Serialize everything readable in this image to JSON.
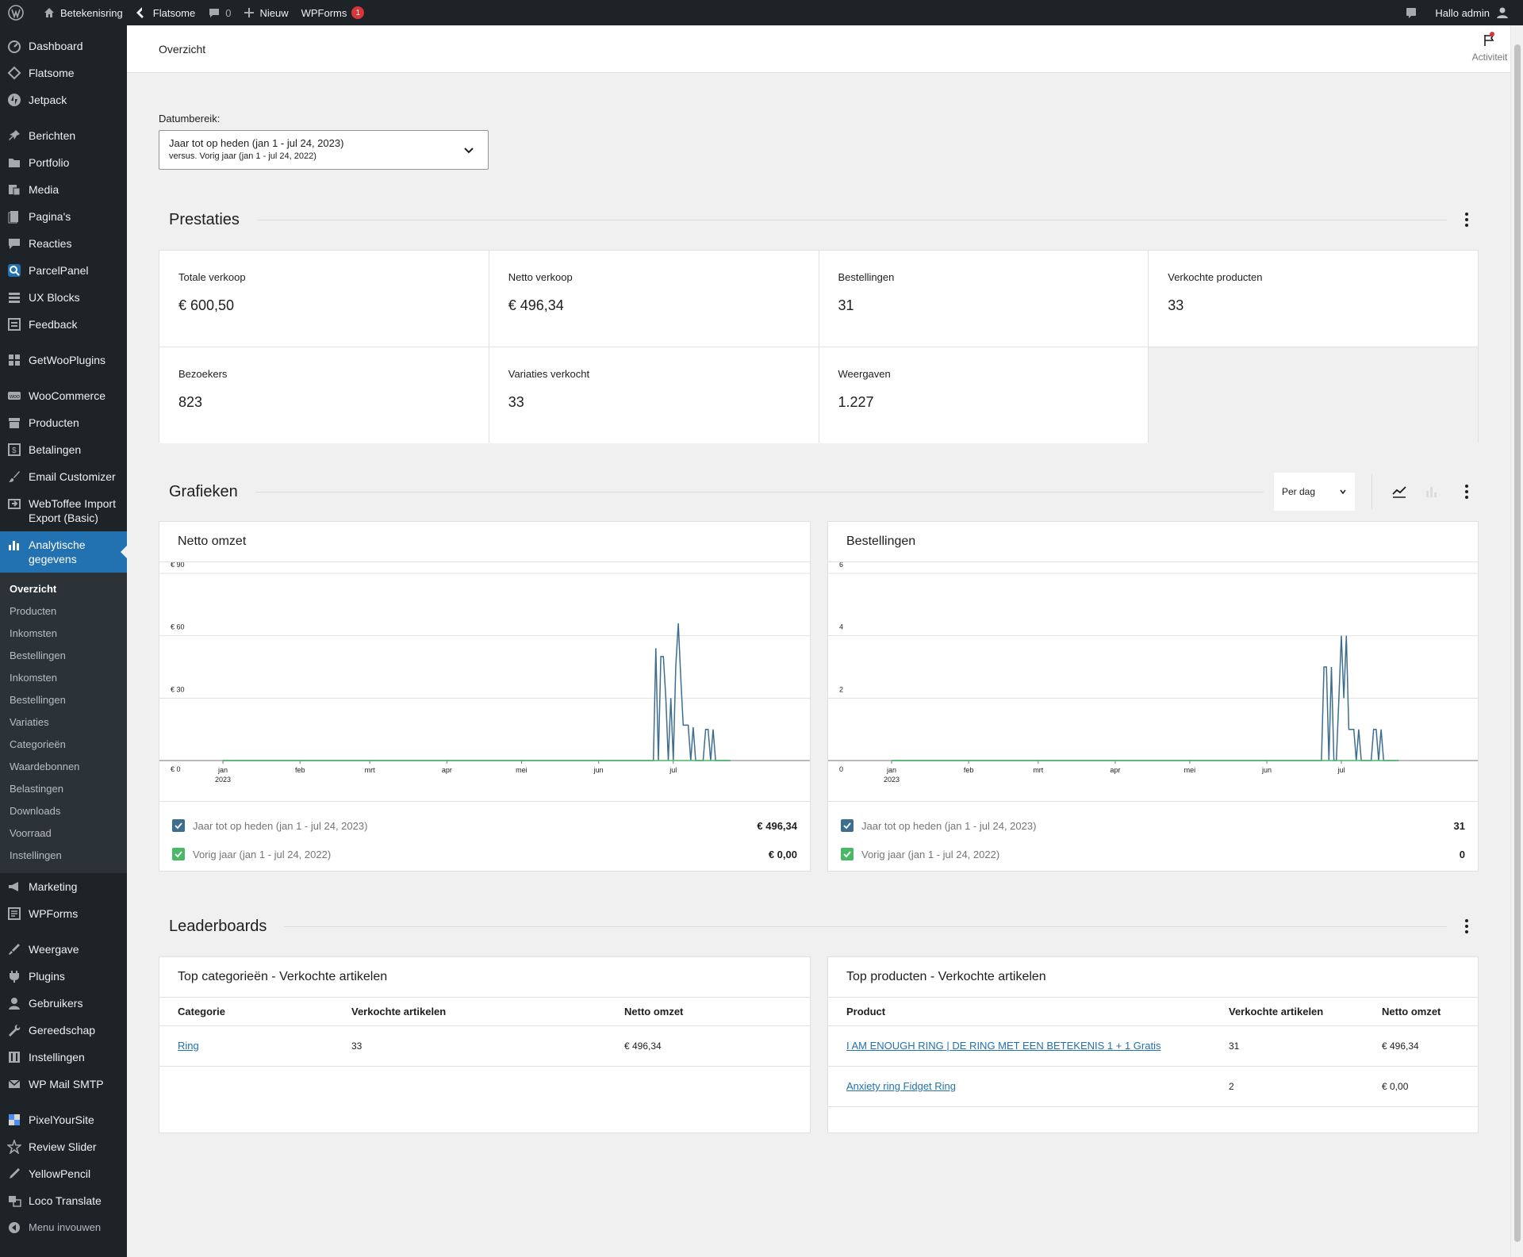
{
  "adminbar": {
    "site_name": "Betekenisring",
    "theme": "Flatsome",
    "comments_count": "0",
    "new_label": "Nieuw",
    "wpforms_label": "WPForms",
    "wpforms_badge": "1",
    "greeting": "Hallo admin"
  },
  "sidebar": {
    "items_top": [
      {
        "label": "Dashboard",
        "icon": "dashboard-icon"
      },
      {
        "label": "Flatsome",
        "icon": "flatsome-icon"
      },
      {
        "label": "Jetpack",
        "icon": "jetpack-icon"
      }
    ],
    "items_content": [
      {
        "label": "Berichten",
        "icon": "pin-icon"
      },
      {
        "label": "Portfolio",
        "icon": "folder-icon"
      },
      {
        "label": "Media",
        "icon": "media-icon"
      },
      {
        "label": "Pagina's",
        "icon": "page-icon"
      },
      {
        "label": "Reacties",
        "icon": "comment-icon"
      },
      {
        "label": "ParcelPanel",
        "icon": "parcel-icon"
      },
      {
        "label": "UX Blocks",
        "icon": "blocks-icon"
      },
      {
        "label": "Feedback",
        "icon": "feedback-icon"
      }
    ],
    "item_getwoo": {
      "label": "GetWooPlugins",
      "icon": "plugin-grid-icon"
    },
    "items_woo": [
      {
        "label": "WooCommerce",
        "icon": "woo-icon"
      },
      {
        "label": "Producten",
        "icon": "archive-icon"
      },
      {
        "label": "Betalingen",
        "icon": "dollar-icon"
      },
      {
        "label": "Email Customizer",
        "icon": "brush-icon"
      },
      {
        "label": "WebToffee Import Export (Basic)",
        "icon": "import-icon"
      }
    ],
    "current_item": {
      "label": "Analytische gegevens",
      "icon": "bar-chart-icon"
    },
    "submenu": [
      "Overzicht",
      "Producten",
      "Inkomsten",
      "Bestellingen",
      "Inkomsten",
      "Bestellingen",
      "Variaties",
      "Categorieën",
      "Waardebonnen",
      "Belastingen",
      "Downloads",
      "Voorraad",
      "Instellingen"
    ],
    "items_marketing": [
      {
        "label": "Marketing",
        "icon": "megaphone-icon"
      },
      {
        "label": "WPForms",
        "icon": "form-icon"
      }
    ],
    "items_admin": [
      {
        "label": "Weergave",
        "icon": "appearance-icon"
      },
      {
        "label": "Plugins",
        "icon": "plugin-icon"
      },
      {
        "label": "Gebruikers",
        "icon": "user-icon"
      },
      {
        "label": "Gereedschap",
        "icon": "wrench-icon"
      },
      {
        "label": "Instellingen",
        "icon": "settings-icon"
      },
      {
        "label": "WP Mail SMTP",
        "icon": "mail-icon"
      }
    ],
    "items_extra": [
      {
        "label": "PixelYourSite",
        "icon": "pixel-icon"
      },
      {
        "label": "Review Slider",
        "icon": "star-icon"
      },
      {
        "label": "YellowPencil",
        "icon": "pencil-icon"
      },
      {
        "label": "Loco Translate",
        "icon": "translate-icon"
      }
    ],
    "collapse_label": "Menu invouwen"
  },
  "header": {
    "title": "Overzicht",
    "activity_label": "Activiteit"
  },
  "date_range": {
    "label": "Datumbereik:",
    "primary": "Jaar tot op heden (jan 1 - jul 24, 2023)",
    "secondary": "versus. Vorig jaar (jan 1 - jul 24, 2022)"
  },
  "performance": {
    "title": "Prestaties",
    "cards": [
      {
        "label": "Totale verkoop",
        "value": "€ 600,50"
      },
      {
        "label": "Netto verkoop",
        "value": "€ 496,34"
      },
      {
        "label": "Bestellingen",
        "value": "31"
      },
      {
        "label": "Verkochte producten",
        "value": "33"
      },
      {
        "label": "Bezoekers",
        "value": "823"
      },
      {
        "label": "Variaties verkocht",
        "value": "33"
      },
      {
        "label": "Weergaven",
        "value": "1.227"
      }
    ]
  },
  "charts_section": {
    "title": "Grafieken",
    "interval": "Per dag"
  },
  "chart_data": [
    {
      "type": "line",
      "title": "Netto omzet",
      "yticks": [
        "€ 0",
        "€ 30",
        "€ 60",
        "€ 90"
      ],
      "ylim": [
        0,
        90
      ],
      "xticks": [
        "jan",
        "feb",
        "mrt",
        "apr",
        "mei",
        "jun",
        "jul"
      ],
      "x_year": "2023",
      "series": [
        {
          "name": "Jaar tot op heden (jan 1 - jul 24, 2023)",
          "color": "#3e6e8f",
          "total": "€ 496,34",
          "spikes": [
            [
              173,
              0
            ],
            [
              174,
              54
            ],
            [
              175,
              0
            ],
            [
              176,
              50
            ],
            [
              177,
              50
            ],
            [
              178,
              30
            ],
            [
              179,
              0
            ],
            [
              180,
              30
            ],
            [
              181,
              0
            ],
            [
              182,
              45
            ],
            [
              183,
              66
            ],
            [
              184,
              40
            ],
            [
              185,
              17
            ],
            [
              186,
              17
            ],
            [
              187,
              17
            ],
            [
              188,
              0
            ],
            [
              189,
              16
            ],
            [
              190,
              0
            ],
            [
              193,
              0
            ],
            [
              194,
              15
            ],
            [
              195,
              15
            ],
            [
              196,
              0
            ],
            [
              197,
              15
            ],
            [
              198,
              0
            ]
          ]
        },
        {
          "name": "Vorig jaar (jan 1 - jul 24, 2022)",
          "color": "#4ab866",
          "total": "€ 0,00",
          "spikes": []
        }
      ]
    },
    {
      "type": "line",
      "title": "Bestellingen",
      "yticks": [
        "0",
        "2",
        "4",
        "6"
      ],
      "ylim": [
        0,
        6
      ],
      "xticks": [
        "jan",
        "feb",
        "mrt",
        "apr",
        "mei",
        "jun",
        "jul"
      ],
      "x_year": "2023",
      "series": [
        {
          "name": "Jaar tot op heden (jan 1 - jul 24, 2023)",
          "color": "#3e6e8f",
          "total": "31",
          "spikes": [
            [
              173,
              0
            ],
            [
              174,
              3
            ],
            [
              175,
              3
            ],
            [
              176,
              0
            ],
            [
              177,
              3
            ],
            [
              178,
              0
            ],
            [
              179,
              0
            ],
            [
              180,
              2
            ],
            [
              181,
              4
            ],
            [
              182,
              2
            ],
            [
              183,
              4
            ],
            [
              184,
              1
            ],
            [
              185,
              1
            ],
            [
              186,
              1
            ],
            [
              187,
              0
            ],
            [
              188,
              1
            ],
            [
              189,
              0
            ],
            [
              193,
              0
            ],
            [
              194,
              1
            ],
            [
              195,
              1
            ],
            [
              196,
              0
            ],
            [
              197,
              1
            ],
            [
              198,
              0
            ]
          ]
        },
        {
          "name": "Vorig jaar (jan 1 - jul 24, 2022)",
          "color": "#4ab866",
          "total": "0",
          "spikes": []
        }
      ]
    }
  ],
  "leaderboards": {
    "title": "Leaderboards",
    "categories": {
      "title": "Top categorieën - Verkochte artikelen",
      "headers": [
        "Categorie",
        "Verkochte artikelen",
        "Netto omzet"
      ],
      "rows": [
        [
          "Ring",
          "33",
          "€ 496,34"
        ]
      ]
    },
    "products": {
      "title": "Top producten - Verkochte artikelen",
      "headers": [
        "Product",
        "Verkochte artikelen",
        "Netto omzet"
      ],
      "rows": [
        [
          "I AM ENOUGH RING | DE RING MET EEN BETEKENIS 1 + 1 Gratis",
          "31",
          "€ 496,34"
        ],
        [
          "Anxiety ring Fidget Ring",
          "2",
          "€ 0,00"
        ]
      ]
    }
  }
}
